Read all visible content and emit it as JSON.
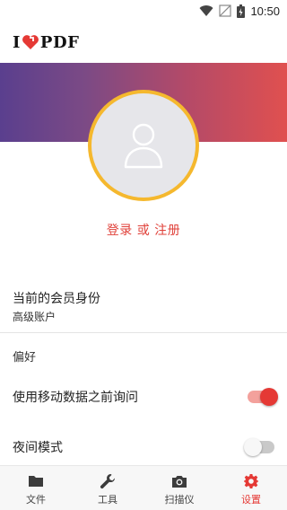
{
  "status_bar": {
    "time": "10:50",
    "icons": [
      "wifi-icon",
      "no-signal-icon",
      "battery-icon"
    ]
  },
  "app_bar": {
    "logo_left": "I",
    "logo_right": "PDF",
    "logo_heart_icon": "heart-icon"
  },
  "colors": {
    "accent": "#e53935",
    "avatar_ring": "#f5b82e",
    "hero_gradient_start": "#5a3f8e",
    "hero_gradient_end": "#e0504f"
  },
  "profile": {
    "avatar_icon": "user-icon",
    "login_text": "登录 或 注册"
  },
  "settings": {
    "membership_title": "当前的会员身份",
    "membership_value": "高级账户",
    "preferences_header": "偏好",
    "mobile_data_label": "使用移动数据之前询问",
    "mobile_data_on": true,
    "night_mode_label": "夜间模式",
    "night_mode_on": false
  },
  "bottom_nav": {
    "items": [
      {
        "label": "文件",
        "icon": "folder-icon",
        "active": false
      },
      {
        "label": "工具",
        "icon": "wrench-icon",
        "active": false
      },
      {
        "label": "扫描仪",
        "icon": "camera-icon",
        "active": false
      },
      {
        "label": "设置",
        "icon": "gear-icon",
        "active": true
      }
    ]
  }
}
